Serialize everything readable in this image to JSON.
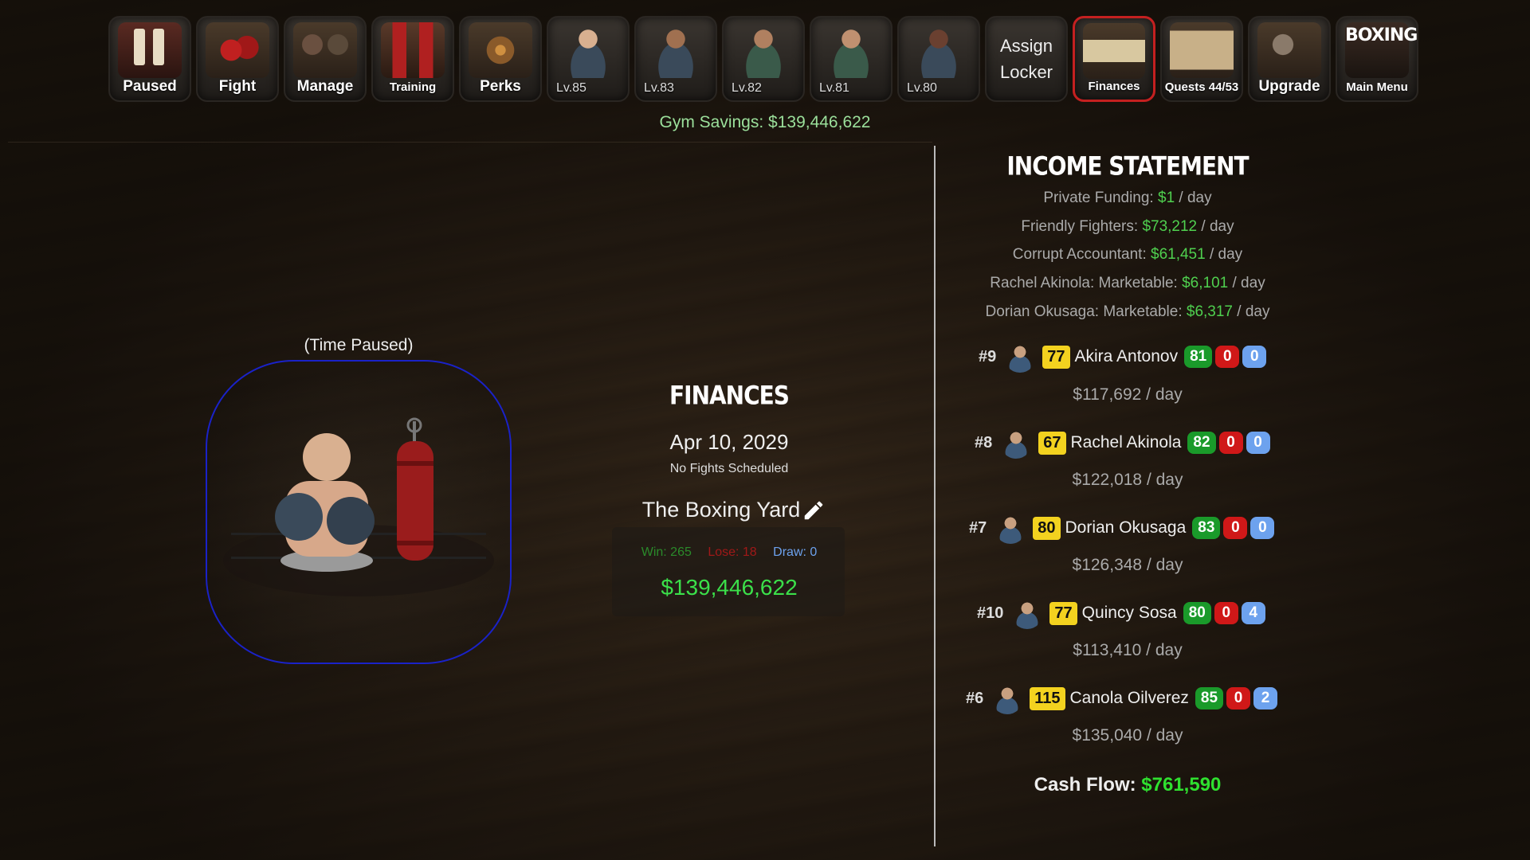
{
  "topbar": {
    "paused": "Paused",
    "fight": "Fight",
    "manage": "Manage",
    "training": "Training",
    "perks": "Perks",
    "fighter_levels": [
      "Lv.85",
      "Lv.83",
      "Lv.82",
      "Lv.81",
      "Lv.80"
    ],
    "assign_locker": "Assign\nLocker",
    "finances": "Finances",
    "quests": "Quests 44/53",
    "upgrade": "Upgrade",
    "main_menu": "Main Menu",
    "logo_text": "BOXING"
  },
  "gym_savings": "Gym Savings: $139,446,622",
  "left": {
    "time_paused": "(Time Paused)"
  },
  "finances": {
    "title": "FINANCES",
    "date": "Apr 10, 2029",
    "schedule": "No Fights Scheduled",
    "gym_name": "The Boxing Yard",
    "win": "Win: 265",
    "lose": "Lose: 18",
    "draw": "Draw: 0",
    "money": "$139,446,622"
  },
  "income": {
    "title": "INCOME STATEMENT",
    "lines": [
      {
        "label": "Private Funding: ",
        "amount": "$1",
        "suffix": " / day"
      },
      {
        "label": "Friendly Fighters: ",
        "amount": "$73,212",
        "suffix": " / day"
      },
      {
        "label": "Corrupt Accountant: ",
        "amount": "$61,451",
        "suffix": " / day"
      },
      {
        "label": "Rachel Akinola: Marketable: ",
        "amount": "$6,101",
        "suffix": " / day"
      },
      {
        "label": "Dorian Okusaga: Marketable: ",
        "amount": "$6,317",
        "suffix": " / day"
      }
    ],
    "fighters": [
      {
        "rank": "#9",
        "ovr": "77",
        "name": "Akira Antonov",
        "w": "81",
        "l": "0",
        "d": "0",
        "per_day": "$117,692 / day"
      },
      {
        "rank": "#8",
        "ovr": "67",
        "name": "Rachel Akinola",
        "w": "82",
        "l": "0",
        "d": "0",
        "per_day": "$122,018 / day"
      },
      {
        "rank": "#7",
        "ovr": "80",
        "name": "Dorian Okusaga",
        "w": "83",
        "l": "0",
        "d": "0",
        "per_day": "$126,348 / day"
      },
      {
        "rank": "#10",
        "ovr": "77",
        "name": "Quincy Sosa",
        "w": "80",
        "l": "0",
        "d": "4",
        "per_day": "$113,410 / day"
      },
      {
        "rank": "#6",
        "ovr": "115",
        "name": "Canola Oilverez",
        "w": "85",
        "l": "0",
        "d": "2",
        "per_day": "$135,040 / day"
      }
    ],
    "cash_flow_label": "Cash Flow: ",
    "cash_flow": "$761,590"
  },
  "colors": {
    "green": "#4fd04f",
    "red_active": "#c42020",
    "circle_border": "#1a22c8",
    "gold": "#f3d21f"
  }
}
